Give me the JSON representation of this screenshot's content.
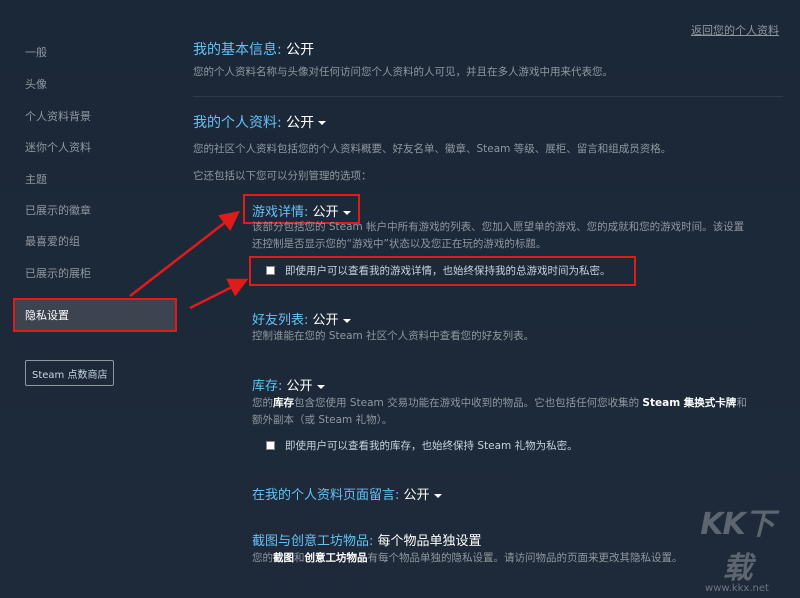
{
  "back_link": "返回您的个人资料",
  "sidebar": {
    "items": [
      "一般",
      "头像",
      "个人资料背景",
      "迷你个人资料",
      "主题",
      "已展示的徽章",
      "最喜爱的组",
      "已展示的展柜"
    ],
    "active_item": "隐私设置",
    "points_shop_button": "Steam 点数商店"
  },
  "basic_info": {
    "title": "我的基本信息:",
    "value": "公开",
    "desc": "您的个人资料名称与头像对任何访问您个人资料的人可见，并且在多人游戏中用来代表您。"
  },
  "my_profile": {
    "title": "我的个人资料:",
    "value": "公开",
    "desc1": "您的社区个人资料包括您的个人资料概要、好友名单、徽章、Steam 等级、展柜、留言和组成员资格。",
    "desc2": "它还包括以下您可以分别管理的选项："
  },
  "game_details": {
    "title": "游戏详情:",
    "value": "公开",
    "desc_line1": "该部分包括您的 Steam 帐户中所有游戏的列表、您加入愿望单的游戏、您的成就和您的游戏时间。该设置",
    "desc_line2": "还控制是否显示您的“游戏中”状态以及您正在玩的游戏的标题。",
    "checkbox_label": "即使用户可以查看我的游戏详情，也始终保持我的总游戏时间为私密。"
  },
  "friends_list": {
    "title": "好友列表:",
    "value": "公开",
    "desc": "控制谁能在您的 Steam 社区个人资料中查看您的好友列表。"
  },
  "inventory": {
    "title": "库存:",
    "value": "公开",
    "desc_p1": "您的",
    "desc_b1": "库存",
    "desc_p2": "包含您使用 Steam 交易功能在游戏中收到的物品。它也包括任何您收集的 ",
    "desc_b2": "Steam 集换式卡牌",
    "desc_p3": "和",
    "desc_line2": "额外副本（或 Steam 礼物）。",
    "checkbox_label": "即使用户可以查看我的库存，也始终保持 Steam 礼物为私密。"
  },
  "comments": {
    "title": "在我的个人资料页面留言:",
    "value": "公开"
  },
  "screenshots": {
    "title": "截图与创意工坊物品:",
    "value": "每个物品单独设置",
    "desc_p1": "您的",
    "desc_b1": "截图",
    "desc_p2": "和",
    "desc_b2": "创意工坊物品",
    "desc_p3": "有每个物品单独的隐私设置。请访问物品的页面来更改其隐私设置。"
  },
  "watermark": {
    "logo": "KK下载",
    "url": "www.kkx.net"
  },
  "colors": {
    "accent": "#66c0f4",
    "highlight": "#e01b1b",
    "background": "#1b2838"
  }
}
